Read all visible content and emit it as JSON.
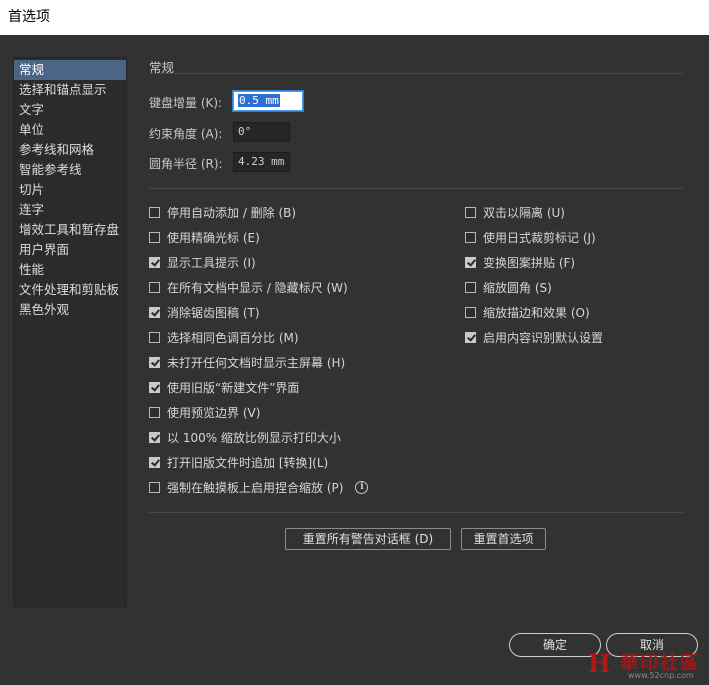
{
  "window": {
    "title": "首选项"
  },
  "sidebar": {
    "items": [
      {
        "label": "常规",
        "selected": true
      },
      {
        "label": "选择和锚点显示"
      },
      {
        "label": "文字"
      },
      {
        "label": "单位"
      },
      {
        "label": "参考线和网格"
      },
      {
        "label": "智能参考线"
      },
      {
        "label": "切片"
      },
      {
        "label": "连字"
      },
      {
        "label": "增效工具和暂存盘"
      },
      {
        "label": "用户界面"
      },
      {
        "label": "性能"
      },
      {
        "label": "文件处理和剪贴板"
      },
      {
        "label": "黑色外观"
      }
    ]
  },
  "main": {
    "section_title": "常规",
    "keyboard_increment": {
      "label": "键盘增量 (K):",
      "value": "0.5 mm"
    },
    "constrain_angle": {
      "label": "约束角度 (A):",
      "value": "0°"
    },
    "corner_radius": {
      "label": "圆角半径 (R):",
      "value": "4.23 mm"
    },
    "left_options": [
      {
        "label": "停用自动添加 / 删除 (B)",
        "checked": false
      },
      {
        "label": "使用精确光标 (E)",
        "checked": false
      },
      {
        "label": "显示工具提示 (I)",
        "checked": true
      },
      {
        "label": "在所有文档中显示 / 隐藏标尺 (W)",
        "checked": false
      },
      {
        "label": "消除锯齿图稿 (T)",
        "checked": true
      },
      {
        "label": "选择相同色调百分比 (M)",
        "checked": false
      },
      {
        "label": "未打开任何文档时显示主屏幕 (H)",
        "checked": true
      },
      {
        "label": "使用旧版“新建文件”界面",
        "checked": true
      },
      {
        "label": "使用预览边界 (V)",
        "checked": false
      },
      {
        "label": "以 100% 缩放比例显示打印大小",
        "checked": true
      },
      {
        "label": "打开旧版文件时追加 [转换](L)",
        "checked": true
      },
      {
        "label": "强制在触摸板上启用捏合缩放 (P)",
        "checked": false
      }
    ],
    "right_options": [
      {
        "label": "双击以隔离 (U)",
        "checked": false
      },
      {
        "label": "使用日式裁剪标记 (J)",
        "checked": false
      },
      {
        "label": "变换图案拼贴 (F)",
        "checked": true
      },
      {
        "label": "缩放圆角 (S)",
        "checked": false
      },
      {
        "label": "缩放描边和效果 (O)",
        "checked": false
      },
      {
        "label": "启用内容识别默认设置",
        "checked": true
      }
    ],
    "reset_warnings_button": "重置所有警告对话框 (D)",
    "reset_prefs_button": "重置首选项"
  },
  "footer": {
    "ok_button": "确定",
    "cancel_button": "取消"
  },
  "watermark": {
    "logo": "H",
    "text": "華印社區",
    "url": "www.52cnp.com"
  }
}
